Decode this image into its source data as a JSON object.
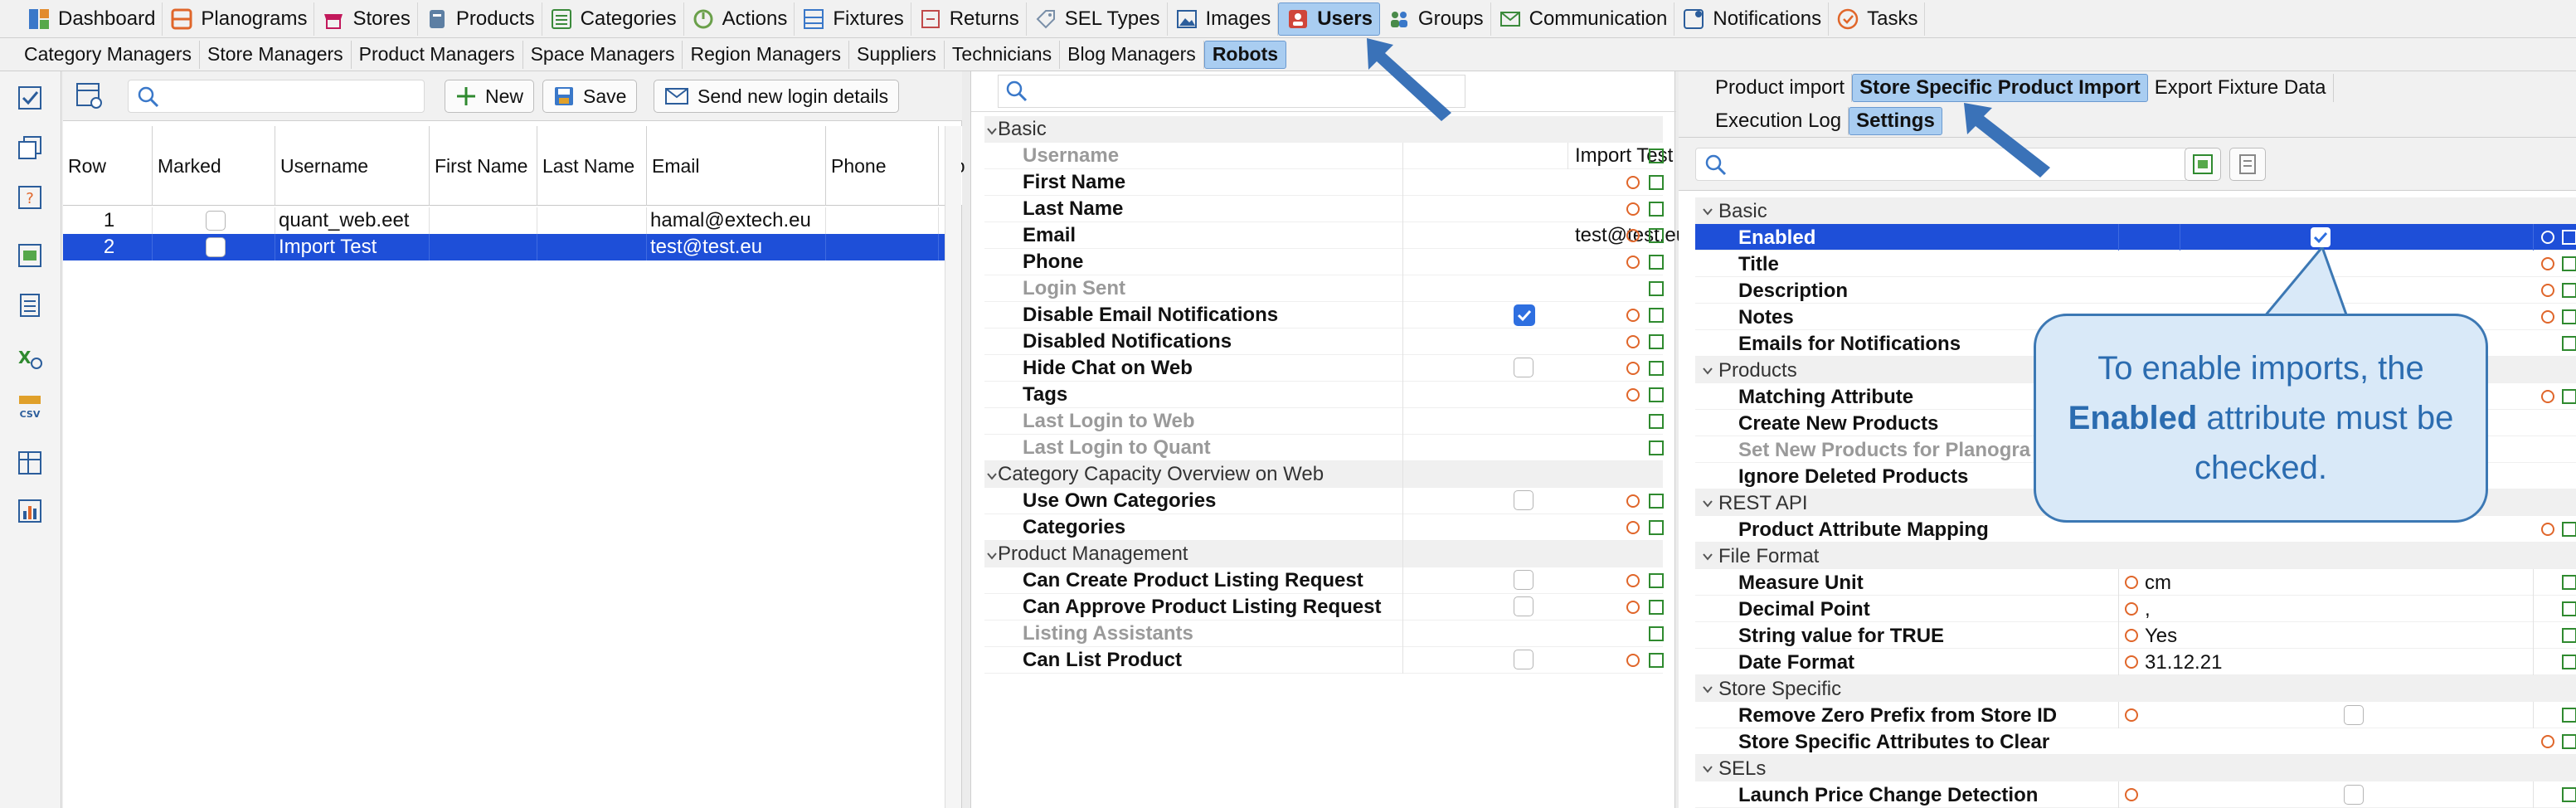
{
  "topbar": {
    "items": [
      {
        "label": "Dashboard",
        "icon": "dashboard-icon"
      },
      {
        "label": "Planograms",
        "icon": "planogram-icon"
      },
      {
        "label": "Stores",
        "icon": "store-icon"
      },
      {
        "label": "Products",
        "icon": "product-icon"
      },
      {
        "label": "Categories",
        "icon": "categories-icon"
      },
      {
        "label": "Actions",
        "icon": "actions-icon"
      },
      {
        "label": "Fixtures",
        "icon": "fixtures-icon"
      },
      {
        "label": "Returns",
        "icon": "returns-icon"
      },
      {
        "label": "SEL Types",
        "icon": "sel-tag-icon"
      },
      {
        "label": "Images",
        "icon": "images-icon"
      },
      {
        "label": "Users",
        "icon": "users-icon",
        "active": true
      },
      {
        "label": "Groups",
        "icon": "groups-icon"
      },
      {
        "label": "Communication",
        "icon": "mail-icon"
      },
      {
        "label": "Notifications",
        "icon": "notifications-icon"
      },
      {
        "label": "Tasks",
        "icon": "tasks-icon"
      }
    ]
  },
  "subtabs": {
    "items": [
      "Category Managers",
      "Store Managers",
      "Product Managers",
      "Space Managers",
      "Region Managers",
      "Suppliers",
      "Technicians",
      "Blog Managers",
      "Robots"
    ],
    "active_index": 8
  },
  "list": {
    "search_placeholder": "",
    "new_label": "New",
    "save_label": "Save",
    "send_label": "Send new login details",
    "columns": [
      "Row",
      "Marked",
      "Username",
      "First Name",
      "Last Name",
      "Email",
      "Phone",
      "Lo"
    ],
    "rows": [
      {
        "row": "1",
        "username": "quant_web.eet",
        "first": "",
        "last": "",
        "email": "hamal@extech.eu",
        "phone": ""
      },
      {
        "row": "2",
        "username": "Import Test",
        "first": "",
        "last": "",
        "email": "test@test.eu",
        "phone": ""
      }
    ],
    "selected_row": 2
  },
  "middle": {
    "groups": {
      "basic": "Basic",
      "category_capacity": "Category Capacity Overview on Web",
      "product_management": "Product Management"
    },
    "props": {
      "username": {
        "label": "Username",
        "value": "Import Test"
      },
      "first_name": {
        "label": "First Name"
      },
      "last_name": {
        "label": "Last Name"
      },
      "email": {
        "label": "Email",
        "value": "test@test.eu"
      },
      "phone": {
        "label": "Phone"
      },
      "login_sent": {
        "label": "Login Sent"
      },
      "disable_email": {
        "label": "Disable Email Notifications",
        "checked": true
      },
      "disabled_notif": {
        "label": "Disabled Notifications"
      },
      "hide_chat": {
        "label": "Hide Chat on Web",
        "checked": false
      },
      "tags": {
        "label": "Tags"
      },
      "last_login_web": {
        "label": "Last Login to Web"
      },
      "last_login_quant": {
        "label": "Last Login to Quant"
      },
      "use_own_categories": {
        "label": "Use Own Categories",
        "checked": false
      },
      "categories": {
        "label": "Categories"
      },
      "can_create_listing": {
        "label": "Can Create Product Listing Request",
        "checked": false
      },
      "can_approve_listing": {
        "label": "Can Approve Product Listing Request",
        "checked": false
      },
      "listing_assistants": {
        "label": "Listing Assistants"
      },
      "can_list_product": {
        "label": "Can List Product",
        "checked": false
      }
    }
  },
  "right": {
    "tabs1": [
      "Product import",
      "Store Specific Product Import",
      "Export Fixture Data"
    ],
    "tabs1_active": 1,
    "tabs2": [
      "Execution Log",
      "Settings"
    ],
    "tabs2_active": 1,
    "groups": {
      "basic": "Basic",
      "products": "Products",
      "rest_api": "REST API",
      "file_format": "File Format",
      "store_specific": "Store Specific",
      "sels": "SELs"
    },
    "props": {
      "enabled": {
        "label": "Enabled",
        "checked": true
      },
      "title": {
        "label": "Title"
      },
      "description": {
        "label": "Description"
      },
      "notes": {
        "label": "Notes"
      },
      "emails_notif": {
        "label": "Emails for Notifications"
      },
      "matching_attr": {
        "label": "Matching Attribute"
      },
      "create_new": {
        "label": "Create New Products"
      },
      "set_new_planogram": {
        "label": "Set New Products for Planogra"
      },
      "ignore_deleted": {
        "label": "Ignore Deleted Products"
      },
      "attr_mapping": {
        "label": "Product Attribute Mapping"
      },
      "measure_unit": {
        "label": "Measure Unit",
        "value": "cm"
      },
      "decimal_point": {
        "label": "Decimal Point",
        "value": ","
      },
      "string_true": {
        "label": "String value for TRUE",
        "value": "Yes"
      },
      "date_format": {
        "label": "Date Format",
        "value": "31.12.21"
      },
      "remove_zero": {
        "label": "Remove Zero Prefix from Store ID",
        "checked": false
      },
      "attrs_clear": {
        "label": "Store Specific Attributes to Clear"
      },
      "launch_price": {
        "label": "Launch Price Change Detection",
        "checked": false
      }
    }
  },
  "callout": {
    "line_pre": "To enable imports, the",
    "bold": "Enabled",
    "line_post": "attribute must be checked."
  },
  "colors": {
    "selection": "#1e4fd8",
    "active_tab": "#a9cdf1",
    "callout_fill": "#d9e9f8",
    "callout_border": "#3c78b4",
    "arrow": "#3c78b4"
  }
}
